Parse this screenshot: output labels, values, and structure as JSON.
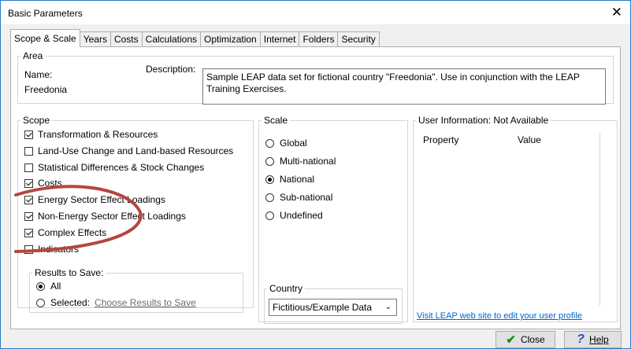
{
  "window": {
    "title": "Basic Parameters",
    "close_glyph": "✕"
  },
  "tabs": [
    {
      "label": "Scope & Scale",
      "active": true
    },
    {
      "label": "Years"
    },
    {
      "label": "Costs"
    },
    {
      "label": "Calculations"
    },
    {
      "label": "Optimization"
    },
    {
      "label": "Internet"
    },
    {
      "label": "Folders"
    },
    {
      "label": "Security"
    }
  ],
  "area": {
    "legend": "Area",
    "name_label": "Name:",
    "name_value": "Freedonia",
    "description_label": "Description:",
    "description_value": "Sample LEAP data set for fictional country \"Freedonia\". Use in conjunction with the LEAP Training Exercises."
  },
  "scope": {
    "legend": "Scope",
    "items": [
      {
        "label": "Transformation & Resources",
        "checked": true
      },
      {
        "label": "Land-Use Change and Land-based Resources",
        "checked": false
      },
      {
        "label": "Statistical Differences & Stock Changes",
        "checked": false
      },
      {
        "label": "Costs",
        "checked": true
      },
      {
        "label": "Energy Sector Effect Loadings",
        "checked": true
      },
      {
        "label": "Non-Energy Sector Effect Loadings",
        "checked": true
      },
      {
        "label": "Complex Effects",
        "checked": true
      },
      {
        "label": "Indicators",
        "checked": false
      }
    ]
  },
  "results": {
    "legend": "Results to Save:",
    "all_label": "All",
    "selected_label": "Selected:",
    "choose_link": "Choose Results to Save"
  },
  "scale": {
    "legend": "Scale",
    "options": [
      {
        "label": "Global",
        "selected": false
      },
      {
        "label": "Multi-national",
        "selected": false
      },
      {
        "label": "National",
        "selected": true
      },
      {
        "label": "Sub-national",
        "selected": false
      },
      {
        "label": "Undefined",
        "selected": false
      }
    ]
  },
  "country": {
    "legend": "Country",
    "value": "Fictitious/Example Data",
    "chevron_icon": "chevron-down-icon"
  },
  "user_info": {
    "legend": "User Information: Not Available",
    "col_property": "Property",
    "col_value": "Value",
    "link": "Visit LEAP web site to edit your user profile"
  },
  "buttons": {
    "close": "Close",
    "help": "Help"
  },
  "colors": {
    "accent": "#2b79c6",
    "annotation": "#b5473b",
    "link": "#0066cc",
    "check": "#1c8a1c"
  }
}
